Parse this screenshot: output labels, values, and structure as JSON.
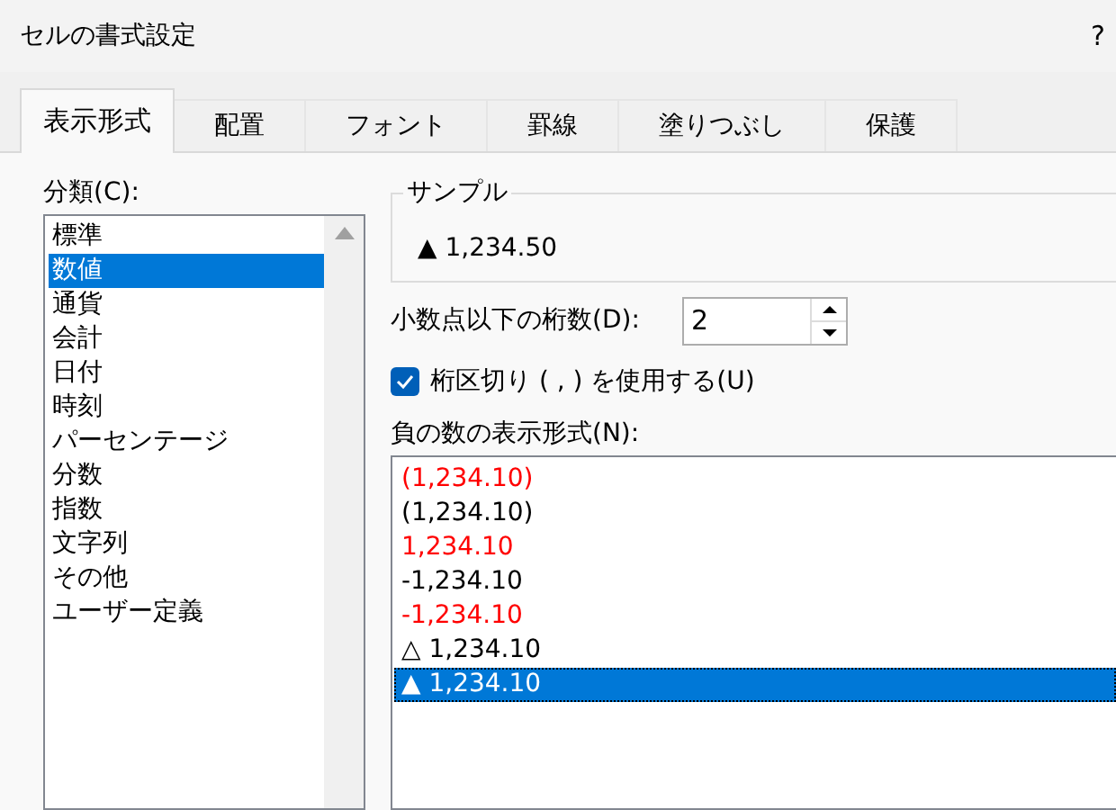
{
  "window": {
    "title": "セルの書式設定",
    "help": "?"
  },
  "tabs": [
    {
      "label": "表示形式",
      "selected": true
    },
    {
      "label": "配置",
      "selected": false
    },
    {
      "label": "フォント",
      "selected": false
    },
    {
      "label": "罫線",
      "selected": false
    },
    {
      "label": "塗りつぶし",
      "selected": false
    },
    {
      "label": "保護",
      "selected": false
    }
  ],
  "category": {
    "label": "分類(C):",
    "items": [
      {
        "label": "標準",
        "selected": false
      },
      {
        "label": "数値",
        "selected": true
      },
      {
        "label": "通貨",
        "selected": false
      },
      {
        "label": "会計",
        "selected": false
      },
      {
        "label": "日付",
        "selected": false
      },
      {
        "label": "時刻",
        "selected": false
      },
      {
        "label": "パーセンテージ",
        "selected": false
      },
      {
        "label": "分数",
        "selected": false
      },
      {
        "label": "指数",
        "selected": false
      },
      {
        "label": "文字列",
        "selected": false
      },
      {
        "label": "その他",
        "selected": false
      },
      {
        "label": "ユーザー定義",
        "selected": false
      }
    ]
  },
  "sample": {
    "label": "サンプル",
    "value": "▲ 1,234.50"
  },
  "decimal_places": {
    "label": "小数点以下の桁数(D):",
    "value": "2"
  },
  "thousands_separator": {
    "label": "桁区切り ( , ) を使用する(U)",
    "checked": true
  },
  "negative_numbers": {
    "label": "負の数の表示形式(N):",
    "items": [
      {
        "label": "(1,234.10)",
        "color": "#ff0000",
        "selected": false
      },
      {
        "label": "(1,234.10)",
        "color": "#000000",
        "selected": false
      },
      {
        "label": "1,234.10",
        "color": "#ff0000",
        "selected": false
      },
      {
        "label": "-1,234.10",
        "color": "#000000",
        "selected": false
      },
      {
        "label": "-1,234.10",
        "color": "#ff0000",
        "selected": false
      },
      {
        "label": "△ 1,234.10",
        "color": "#000000",
        "selected": false
      },
      {
        "label": "▲ 1,234.10",
        "selected": true
      }
    ]
  }
}
